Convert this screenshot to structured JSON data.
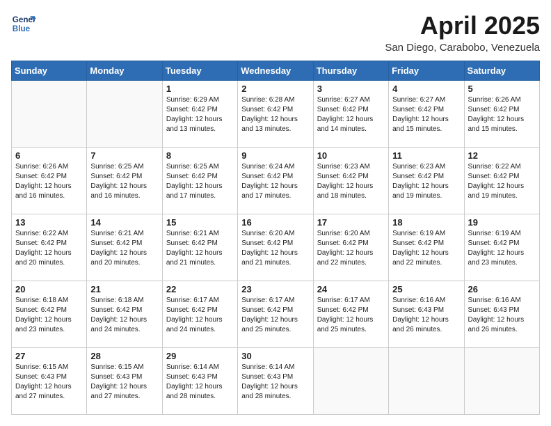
{
  "logo": {
    "line1": "General",
    "line2": "Blue"
  },
  "title": "April 2025",
  "location": "San Diego, Carabobo, Venezuela",
  "days_of_week": [
    "Sunday",
    "Monday",
    "Tuesday",
    "Wednesday",
    "Thursday",
    "Friday",
    "Saturday"
  ],
  "weeks": [
    [
      {
        "day": "",
        "text": ""
      },
      {
        "day": "",
        "text": ""
      },
      {
        "day": "1",
        "text": "Sunrise: 6:29 AM\nSunset: 6:42 PM\nDaylight: 12 hours and 13 minutes."
      },
      {
        "day": "2",
        "text": "Sunrise: 6:28 AM\nSunset: 6:42 PM\nDaylight: 12 hours and 13 minutes."
      },
      {
        "day": "3",
        "text": "Sunrise: 6:27 AM\nSunset: 6:42 PM\nDaylight: 12 hours and 14 minutes."
      },
      {
        "day": "4",
        "text": "Sunrise: 6:27 AM\nSunset: 6:42 PM\nDaylight: 12 hours and 15 minutes."
      },
      {
        "day": "5",
        "text": "Sunrise: 6:26 AM\nSunset: 6:42 PM\nDaylight: 12 hours and 15 minutes."
      }
    ],
    [
      {
        "day": "6",
        "text": "Sunrise: 6:26 AM\nSunset: 6:42 PM\nDaylight: 12 hours and 16 minutes."
      },
      {
        "day": "7",
        "text": "Sunrise: 6:25 AM\nSunset: 6:42 PM\nDaylight: 12 hours and 16 minutes."
      },
      {
        "day": "8",
        "text": "Sunrise: 6:25 AM\nSunset: 6:42 PM\nDaylight: 12 hours and 17 minutes."
      },
      {
        "day": "9",
        "text": "Sunrise: 6:24 AM\nSunset: 6:42 PM\nDaylight: 12 hours and 17 minutes."
      },
      {
        "day": "10",
        "text": "Sunrise: 6:23 AM\nSunset: 6:42 PM\nDaylight: 12 hours and 18 minutes."
      },
      {
        "day": "11",
        "text": "Sunrise: 6:23 AM\nSunset: 6:42 PM\nDaylight: 12 hours and 19 minutes."
      },
      {
        "day": "12",
        "text": "Sunrise: 6:22 AM\nSunset: 6:42 PM\nDaylight: 12 hours and 19 minutes."
      }
    ],
    [
      {
        "day": "13",
        "text": "Sunrise: 6:22 AM\nSunset: 6:42 PM\nDaylight: 12 hours and 20 minutes."
      },
      {
        "day": "14",
        "text": "Sunrise: 6:21 AM\nSunset: 6:42 PM\nDaylight: 12 hours and 20 minutes."
      },
      {
        "day": "15",
        "text": "Sunrise: 6:21 AM\nSunset: 6:42 PM\nDaylight: 12 hours and 21 minutes."
      },
      {
        "day": "16",
        "text": "Sunrise: 6:20 AM\nSunset: 6:42 PM\nDaylight: 12 hours and 21 minutes."
      },
      {
        "day": "17",
        "text": "Sunrise: 6:20 AM\nSunset: 6:42 PM\nDaylight: 12 hours and 22 minutes."
      },
      {
        "day": "18",
        "text": "Sunrise: 6:19 AM\nSunset: 6:42 PM\nDaylight: 12 hours and 22 minutes."
      },
      {
        "day": "19",
        "text": "Sunrise: 6:19 AM\nSunset: 6:42 PM\nDaylight: 12 hours and 23 minutes."
      }
    ],
    [
      {
        "day": "20",
        "text": "Sunrise: 6:18 AM\nSunset: 6:42 PM\nDaylight: 12 hours and 23 minutes."
      },
      {
        "day": "21",
        "text": "Sunrise: 6:18 AM\nSunset: 6:42 PM\nDaylight: 12 hours and 24 minutes."
      },
      {
        "day": "22",
        "text": "Sunrise: 6:17 AM\nSunset: 6:42 PM\nDaylight: 12 hours and 24 minutes."
      },
      {
        "day": "23",
        "text": "Sunrise: 6:17 AM\nSunset: 6:42 PM\nDaylight: 12 hours and 25 minutes."
      },
      {
        "day": "24",
        "text": "Sunrise: 6:17 AM\nSunset: 6:42 PM\nDaylight: 12 hours and 25 minutes."
      },
      {
        "day": "25",
        "text": "Sunrise: 6:16 AM\nSunset: 6:43 PM\nDaylight: 12 hours and 26 minutes."
      },
      {
        "day": "26",
        "text": "Sunrise: 6:16 AM\nSunset: 6:43 PM\nDaylight: 12 hours and 26 minutes."
      }
    ],
    [
      {
        "day": "27",
        "text": "Sunrise: 6:15 AM\nSunset: 6:43 PM\nDaylight: 12 hours and 27 minutes."
      },
      {
        "day": "28",
        "text": "Sunrise: 6:15 AM\nSunset: 6:43 PM\nDaylight: 12 hours and 27 minutes."
      },
      {
        "day": "29",
        "text": "Sunrise: 6:14 AM\nSunset: 6:43 PM\nDaylight: 12 hours and 28 minutes."
      },
      {
        "day": "30",
        "text": "Sunrise: 6:14 AM\nSunset: 6:43 PM\nDaylight: 12 hours and 28 minutes."
      },
      {
        "day": "",
        "text": ""
      },
      {
        "day": "",
        "text": ""
      },
      {
        "day": "",
        "text": ""
      }
    ]
  ]
}
